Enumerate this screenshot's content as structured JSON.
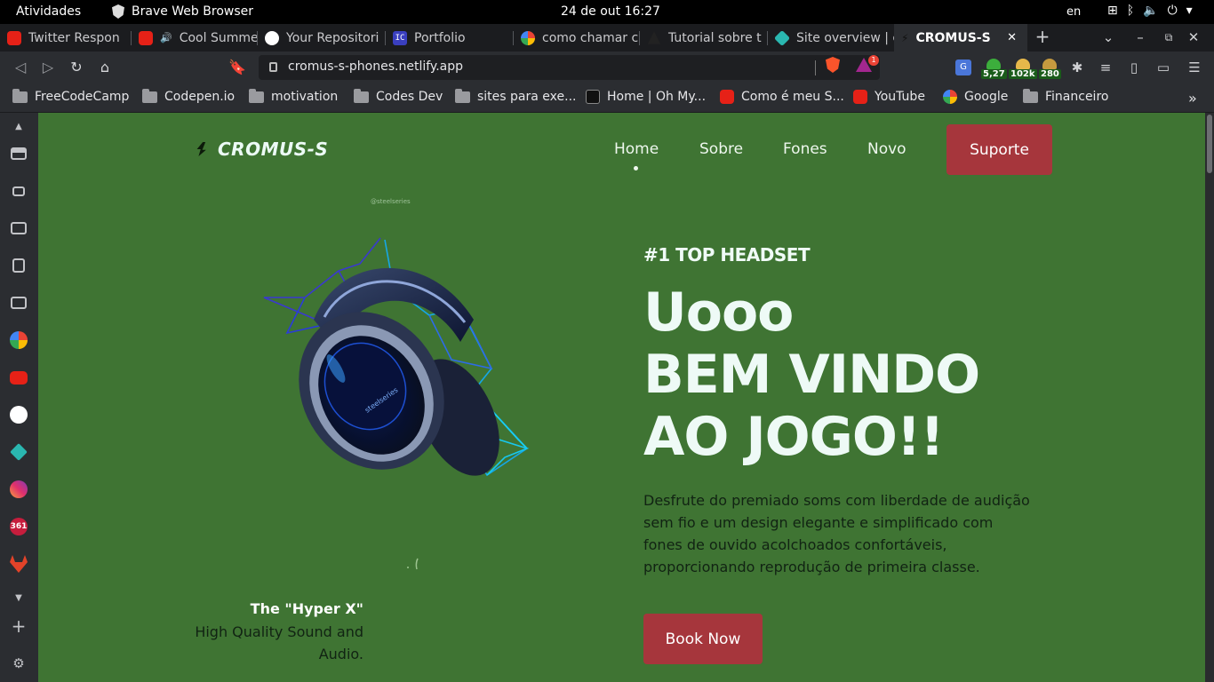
{
  "system_bar": {
    "activities": "Atividades",
    "app_name": "Brave Web Browser",
    "clock": "24 de out  16:27",
    "language": "en"
  },
  "tabs": [
    {
      "title": "Twitter Respon",
      "icon": "youtube-icon"
    },
    {
      "title": "Cool Summe",
      "icon": "youtube-icon"
    },
    {
      "title": "Your Repositori",
      "icon": "github-icon"
    },
    {
      "title": "Portfolio",
      "icon": "ic-icon"
    },
    {
      "title": "como chamar c",
      "icon": "google-icon"
    },
    {
      "title": "Tutorial sobre t",
      "icon": "tutorial-icon"
    },
    {
      "title": "Site overview | c",
      "icon": "netlify-icon"
    },
    {
      "title": "CROMUS-S",
      "icon": "cromus-icon",
      "active": true
    }
  ],
  "address_bar": {
    "url": "cromus-s-phones.netlify.app",
    "rewards_badge": "1"
  },
  "extensions": [
    {
      "label": "5,27",
      "color": "#3cae3c"
    },
    {
      "label": "102k",
      "color": "#e6b84a"
    },
    {
      "label": "280",
      "color": "#c59a3f"
    }
  ],
  "bookmarks": [
    {
      "label": "FreeCodeCamp",
      "icon": "folder-icon"
    },
    {
      "label": "Codepen.io",
      "icon": "folder-icon"
    },
    {
      "label": "motivation",
      "icon": "folder-icon"
    },
    {
      "label": "Codes Dev",
      "icon": "folder-icon"
    },
    {
      "label": "sites para exe...",
      "icon": "folder-icon"
    },
    {
      "label": "Home | Oh My...",
      "icon": "page-icon"
    },
    {
      "label": "Como é meu S...",
      "icon": "youtube-icon"
    },
    {
      "label": "YouTube",
      "icon": "youtube-icon"
    },
    {
      "label": "Google",
      "icon": "google-icon"
    },
    {
      "label": "Financeiro",
      "icon": "folder-icon"
    }
  ],
  "sidebar": {
    "badge_361": "361"
  },
  "site": {
    "logo": "CROMUS-S",
    "nav": [
      "Home",
      "Sobre",
      "Fones",
      "Novo"
    ],
    "support_button": "Suporte",
    "credit": "@steelseries",
    "tagline": "#1 TOP HEADSET",
    "title_lines": [
      "Uooo",
      "BEM VINDO",
      "AO JOGO!!"
    ],
    "description": "Desfrute do premiado soms com liberdade de audição sem fio e um design elegante e simplificado com fones de ouvido acolchoados confortáveis, proporcionando reprodução de primeira classe.",
    "book_button": "Book Now",
    "product_name": "The \"Hyper X\"",
    "product_desc": "High Quality Sound and Audio.",
    "colors": {
      "background": "#3f7433",
      "accent": "#a6363c"
    }
  }
}
